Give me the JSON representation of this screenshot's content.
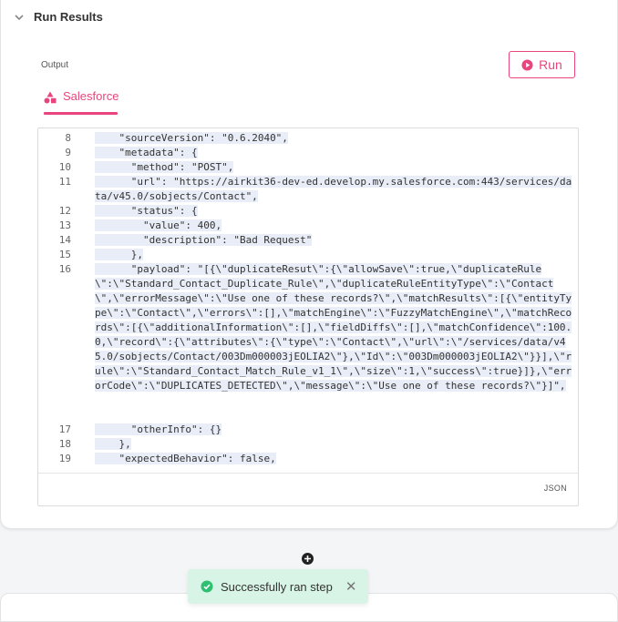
{
  "section": {
    "title": "Run Results"
  },
  "output": {
    "label": "Output"
  },
  "run_button": {
    "label": "Run"
  },
  "tabs": [
    {
      "label": "Salesforce"
    }
  ],
  "code": {
    "format": "JSON",
    "lines": [
      {
        "num": "8",
        "text": "    \"sourceVersion\": \"0.6.2040\","
      },
      {
        "num": "9",
        "text": "    \"metadata\": {"
      },
      {
        "num": "10",
        "text": "      \"method\": \"POST\","
      },
      {
        "num": "11",
        "text": "      \"url\": \"https://airkit36-dev-ed.develop.my.salesforce.com:443/services/data/v45.0/sobjects/Contact\","
      },
      {
        "num": "12",
        "text": "      \"status\": {"
      },
      {
        "num": "13",
        "text": "        \"value\": 400,"
      },
      {
        "num": "14",
        "text": "        \"description\": \"Bad Request\""
      },
      {
        "num": "15",
        "text": "      },"
      },
      {
        "num": "16",
        "text": "      \"payload\": \"[{\\\"duplicateResut\\\":{\\\"allowSave\\\":true,\\\"duplicateRule\\\":\\\"Standard_Contact_Duplicate_Rule\\\",\\\"duplicateRuleEntityType\\\":\\\"Contact\\\",\\\"errorMessage\\\":\\\"Use one of these records?\\\",\\\"matchResults\\\":[{\\\"entityType\\\":\\\"Contact\\\",\\\"errors\\\":[],\\\"matchEngine\\\":\\\"FuzzyMatchEngine\\\",\\\"matchRecords\\\":[{\\\"additionalInformation\\\":[],\\\"fieldDiffs\\\":[],\\\"matchConfidence\\\":100.0,\\\"record\\\":{\\\"attributes\\\":{\\\"type\\\":\\\"Contact\\\",\\\"url\\\":\\\"/services/data/v45.0/sobjects/Contact/003Dm000003jEOLIA2\\\"},\\\"Id\\\":\\\"003Dm000003jEOLIA2\\\"}}],\\\"rule\\\":\\\"Standard_Contact_Match_Rule_v1_1\\\",\\\"size\\\":1,\\\"success\\\":true}]},\\\"errorCode\\\":\\\"DUPLICATES_DETECTED\\\",\\\"message\\\":\\\"Use one of these records?\\\"}]\","
      },
      {
        "num": "17",
        "text": "      \"otherInfo\": {}"
      },
      {
        "num": "18",
        "text": "    },"
      },
      {
        "num": "19",
        "text": "    \"expectedBehavior\": false,"
      }
    ]
  },
  "toast": {
    "message": "Successfully ran step",
    "close": "✕"
  },
  "colors": {
    "accent": "#e8457e",
    "success": "#d8f4e6",
    "success_icon": "#2fbf71"
  }
}
